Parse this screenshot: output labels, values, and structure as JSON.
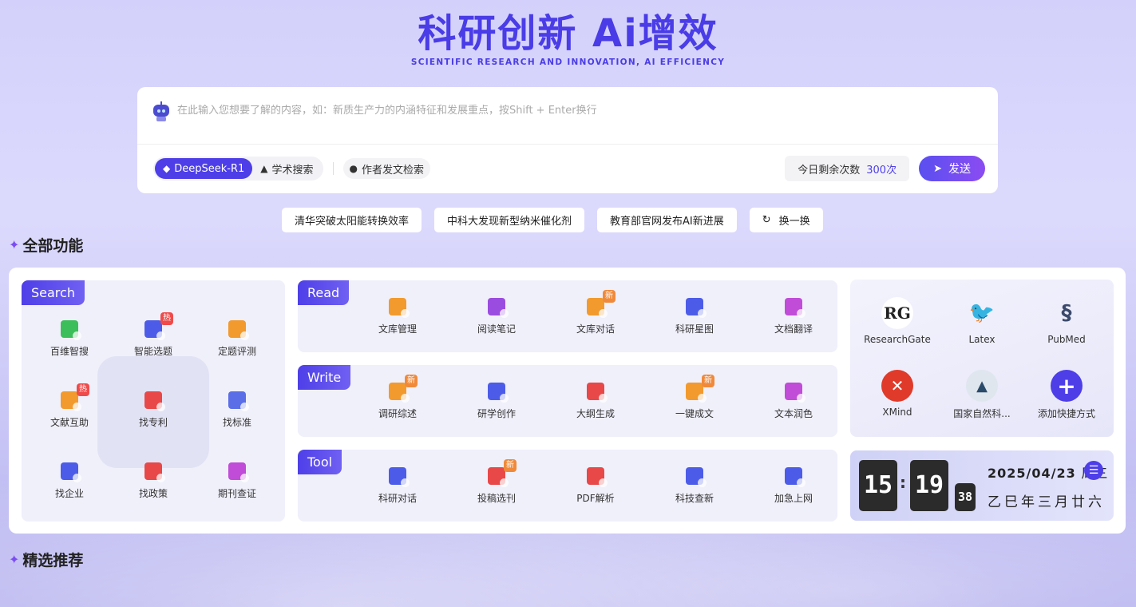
{
  "hero": {
    "title": "科研创新 Ai增效",
    "subtitle": "SCIENTIFIC RESEARCH AND INNOVATION, AI EFFICIENCY"
  },
  "search": {
    "placeholder": "在此输入您想要了解的内容，如：新质生产力的内涵特征和发展重点，按Shift + Enter换行",
    "mode_deepseek": "DeepSeek-R1",
    "mode_academic": "学术搜索",
    "author_search": "作者发文检索",
    "quota_label": "今日剩余次数",
    "quota_value": "300次",
    "send_label": "发送"
  },
  "topics": [
    "清华突破太阳能转换效率",
    "中科大发现新型纳米催化剂",
    "教育部官网发布AI新进展"
  ],
  "refresh_label": "换一换",
  "sections": {
    "all_features": "全部功能",
    "recommended": "精选推荐"
  },
  "search_card": {
    "tag": "Search",
    "items": [
      {
        "label": "百维智搜",
        "color": "#3cbf5a",
        "badge": ""
      },
      {
        "label": "智能选题",
        "color": "#4d5ce8",
        "badge": "热"
      },
      {
        "label": "定题评测",
        "color": "#f29a2e",
        "badge": ""
      },
      {
        "label": "文献互助",
        "color": "#f29a2e",
        "badge": "热"
      },
      {
        "label": "找专利",
        "color": "#e84848",
        "badge": ""
      },
      {
        "label": "找标准",
        "color": "#5b6ee8",
        "badge": ""
      },
      {
        "label": "找企业",
        "color": "#4d5ce8",
        "badge": ""
      },
      {
        "label": "找政策",
        "color": "#e84848",
        "badge": ""
      },
      {
        "label": "期刊查证",
        "color": "#c04cd8",
        "badge": ""
      }
    ]
  },
  "read_card": {
    "tag": "Read",
    "items": [
      {
        "label": "文库管理",
        "color": "#f29a2e",
        "badge": ""
      },
      {
        "label": "阅读笔记",
        "color": "#9b4ce0",
        "badge": ""
      },
      {
        "label": "文库对话",
        "color": "#f29a2e",
        "badge": "新"
      },
      {
        "label": "科研星图",
        "color": "#4d5ce8",
        "badge": ""
      },
      {
        "label": "文档翻译",
        "color": "#c04cd8",
        "badge": ""
      }
    ]
  },
  "write_card": {
    "tag": "Write",
    "items": [
      {
        "label": "调研综述",
        "color": "#f29a2e",
        "badge": "新"
      },
      {
        "label": "研学创作",
        "color": "#4d5ce8",
        "badge": ""
      },
      {
        "label": "大纲生成",
        "color": "#e84848",
        "badge": ""
      },
      {
        "label": "一键成文",
        "color": "#f29a2e",
        "badge": "新"
      },
      {
        "label": "文本润色",
        "color": "#c04cd8",
        "badge": ""
      }
    ]
  },
  "tool_card": {
    "tag": "Tool",
    "items": [
      {
        "label": "科研对话",
        "color": "#4d5ce8",
        "badge": ""
      },
      {
        "label": "投稿选刊",
        "color": "#e84848",
        "badge": "新"
      },
      {
        "label": "PDF解析",
        "color": "#e84848",
        "badge": ""
      },
      {
        "label": "科技查新",
        "color": "#4d5ce8",
        "badge": ""
      },
      {
        "label": "加急上网",
        "color": "#4d5ce8",
        "badge": ""
      }
    ]
  },
  "shortcuts": [
    {
      "label": "ResearchGate",
      "logo": "RG"
    },
    {
      "label": "Latex",
      "logo": "hummingbird-icon"
    },
    {
      "label": "PubMed",
      "logo": "helix-icon"
    },
    {
      "label": "XMind",
      "logo": "xmind-icon"
    },
    {
      "label": "国家自然科...",
      "logo": "nsfc-icon"
    },
    {
      "label": "添加快捷方式",
      "logo": "+"
    }
  ],
  "clock": {
    "hour": "15",
    "minute": "19",
    "second": "38",
    "date": "2025/04/23",
    "weekday": "周三",
    "lunar": "乙巳年三月廿六"
  }
}
